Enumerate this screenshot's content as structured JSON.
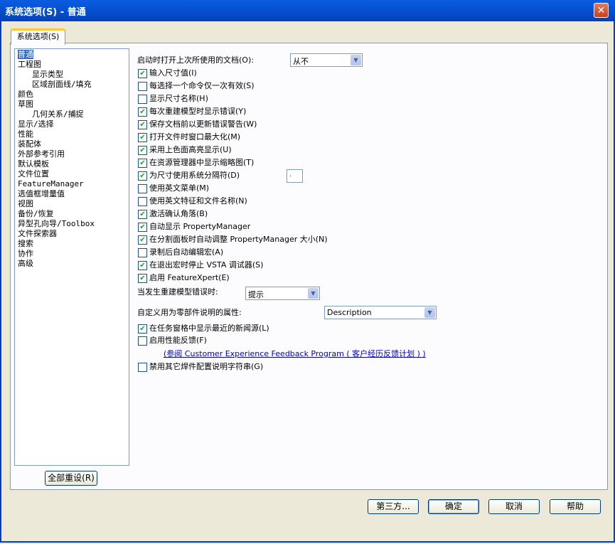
{
  "window": {
    "title": "系统选项(S) - 普通",
    "close_glyph": "✕"
  },
  "tab": {
    "label": "系统选项(S)"
  },
  "tree": {
    "items": [
      "普通",
      "工程图",
      "显示类型",
      "区域剖面线/填充",
      "颜色",
      "草图",
      "几何关系/捕捉",
      "显示/选择",
      "性能",
      "装配体",
      "外部参考引用",
      "默认模板",
      "文件位置",
      "FeatureManager",
      "选值框增量值",
      "视图",
      "备份/恢复",
      "异型孔向导/Toolbox",
      "文件探索器",
      "搜索",
      "协作",
      "高级"
    ]
  },
  "reset_button": "全部重设(R)",
  "open_docs": {
    "label": "启动时打开上次所使用的文档(O):",
    "value": "从不"
  },
  "options": [
    {
      "label": "输入尺寸值(I)",
      "checked": true
    },
    {
      "label": "每选择一个命令仅一次有效(S)",
      "checked": false
    },
    {
      "label": "显示尺寸名称(H)",
      "checked": false
    },
    {
      "label": "每次重建模型时显示错误(Y)",
      "checked": true
    },
    {
      "label": "保存文档前以更新错误警告(W)",
      "checked": true
    },
    {
      "label": "打开文件时窗口最大化(M)",
      "checked": true
    },
    {
      "label": "采用上色面高亮显示(U)",
      "checked": true
    },
    {
      "label": "在资源管理器中显示缩略图(T)",
      "checked": true
    },
    {
      "label": "为尺寸使用系统分隔符(D)",
      "checked": true
    },
    {
      "label": "使用英文菜单(M)",
      "checked": false
    },
    {
      "label": "使用英文特征和文件名称(N)",
      "checked": false
    },
    {
      "label": "激活确认角落(B)",
      "checked": true
    },
    {
      "label": "自动显示 PropertyManager",
      "checked": true
    },
    {
      "label": "在分割面板时自动调整 PropertyManager 大小(N)",
      "checked": true
    },
    {
      "label": "录制后自动编辑宏(A)",
      "checked": false
    },
    {
      "label": "在退出宏时停止 VSTA 调试器(S)",
      "checked": true
    },
    {
      "label": "启用 FeatureXpert(E)",
      "checked": true
    }
  ],
  "separator_value": ".",
  "rebuild_error": {
    "label": "当发生重建模型错误时:",
    "value": "提示"
  },
  "custom_prop": {
    "label": "自定义用为零部件说明的属性:",
    "value": "Description"
  },
  "news": {
    "label": "在任务窗格中显示最近的新闻源(L)",
    "checked": true
  },
  "perf_feedback": {
    "label": "启用性能反馈(F)",
    "checked": false
  },
  "feedback_link": "(参阅 Customer Experience Feedback Program ( 客户经历反馈计划 ) )",
  "disable_config": {
    "label": "禁用其它焊件配置说明字符串(G)",
    "checked": false
  },
  "buttons": {
    "third_party": "第三方...",
    "ok": "确定",
    "cancel": "取消",
    "help": "帮助"
  }
}
